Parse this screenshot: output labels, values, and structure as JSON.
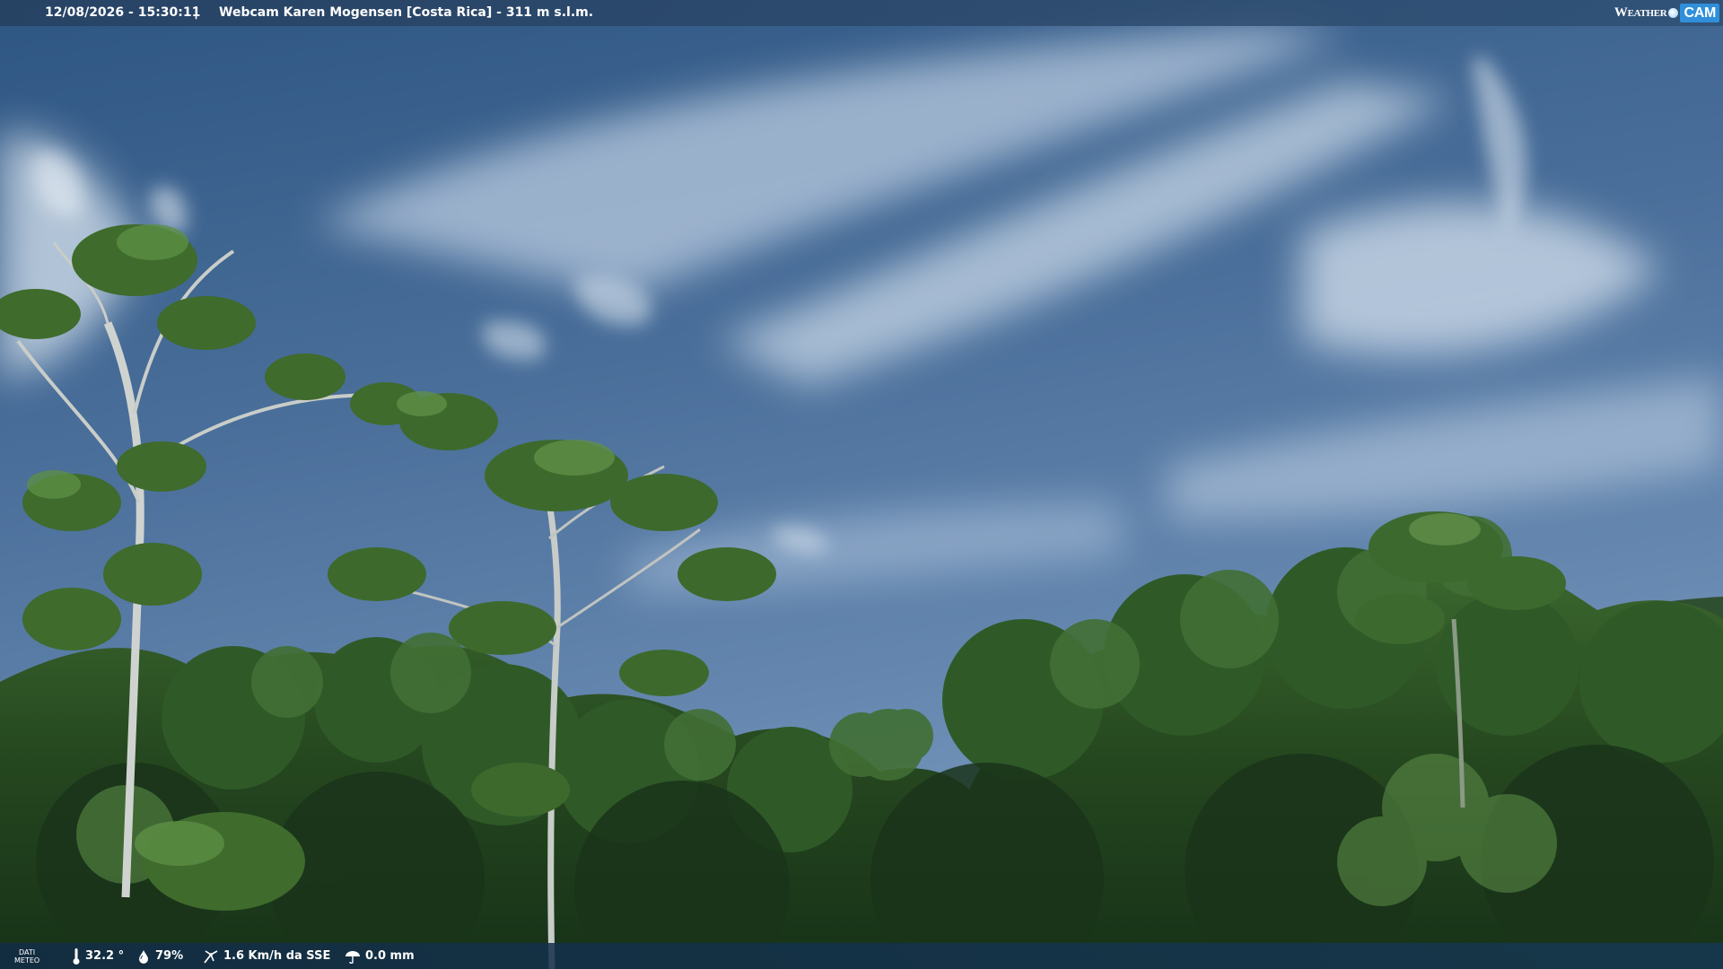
{
  "overlay": {
    "datetime": "12/08/2026 - 15:30:11",
    "separator": "|",
    "title": "Webcam Karen Mogensen [Costa Rica]  - 311 m s.l.m."
  },
  "brand": {
    "weather": "Weather",
    "cam": "CAM"
  },
  "weather_data": {
    "label_line1": "DATI",
    "label_line2": "METEO",
    "temperature": "32.2 °",
    "humidity": "79%",
    "wind": "1.6 Km/h da SSE",
    "rain": "0.0 mm"
  },
  "icons": {
    "temperature": "thermometer-icon",
    "humidity": "drop-icon",
    "wind": "wind-icon",
    "rain": "rain-gauge-icon"
  },
  "colors": {
    "sky_top": "#2d5580",
    "sky_bottom": "#6d8fb6",
    "foliage_dark": "#1c3a1b",
    "foliage_light": "#4f7a37",
    "brand_accent": "#2f8fdb"
  }
}
